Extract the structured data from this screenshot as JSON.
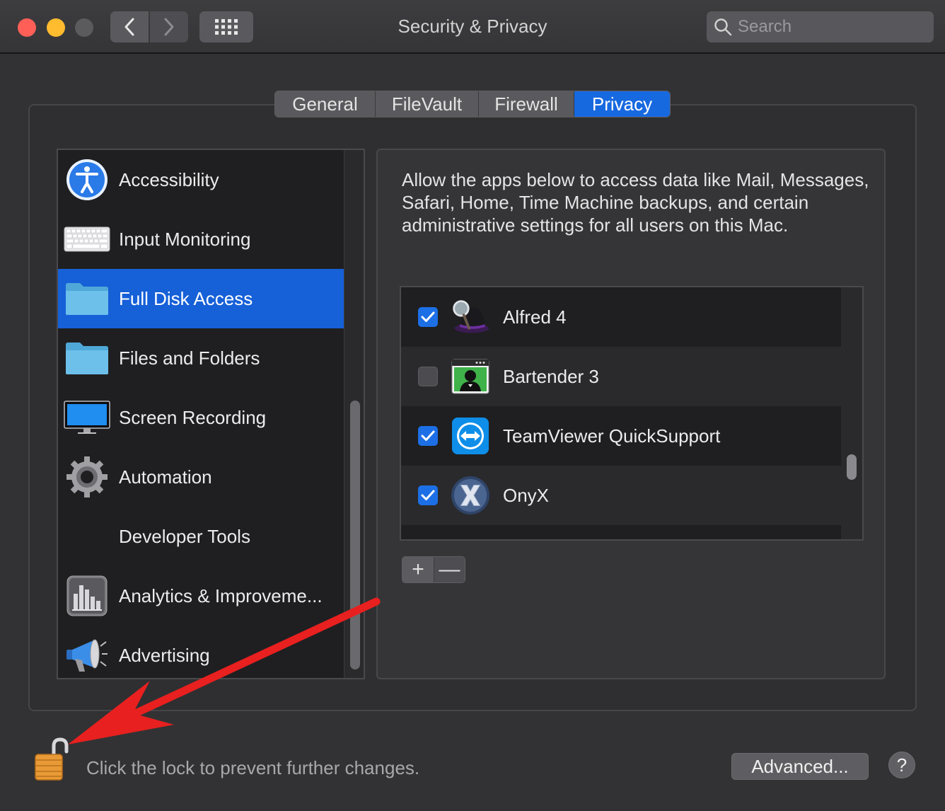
{
  "window": {
    "title": "Security & Privacy",
    "search_placeholder": "Search"
  },
  "tabs": [
    {
      "label": "General"
    },
    {
      "label": "FileVault"
    },
    {
      "label": "Firewall"
    },
    {
      "label": "Privacy",
      "active": true
    }
  ],
  "sidebar": {
    "items": [
      {
        "label": "Accessibility",
        "icon": "accessibility-icon"
      },
      {
        "label": "Input Monitoring",
        "icon": "keyboard-icon"
      },
      {
        "label": "Full Disk Access",
        "icon": "folder-icon",
        "selected": true
      },
      {
        "label": "Files and Folders",
        "icon": "folder-icon"
      },
      {
        "label": "Screen Recording",
        "icon": "display-icon"
      },
      {
        "label": "Automation",
        "icon": "gear-icon"
      },
      {
        "label": "Developer Tools",
        "icon": ""
      },
      {
        "label": "Analytics & Improveme...",
        "icon": "bar-chart-icon"
      },
      {
        "label": "Advertising",
        "icon": "megaphone-icon"
      }
    ]
  },
  "main": {
    "description": "Allow the apps below to access data like Mail, Messages, Safari, Home, Time Machine backups, and certain administrative settings for all users on this Mac.",
    "apps": [
      {
        "label": "Alfred 4",
        "checked": true,
        "icon": "alfred-icon"
      },
      {
        "label": "Bartender 3",
        "checked": false,
        "icon": "bartender-icon"
      },
      {
        "label": "TeamViewer QuickSupport",
        "checked": true,
        "icon": "teamviewer-icon"
      },
      {
        "label": "OnyX",
        "checked": true,
        "icon": "onyx-icon"
      }
    ],
    "add_label": "+",
    "remove_label": "—"
  },
  "footer": {
    "lock_text": "Click the lock to prevent further changes.",
    "advanced_label": "Advanced...",
    "help_label": "?"
  },
  "colors": {
    "accent": "#1769e0",
    "annotation_arrow": "#e8201f"
  }
}
